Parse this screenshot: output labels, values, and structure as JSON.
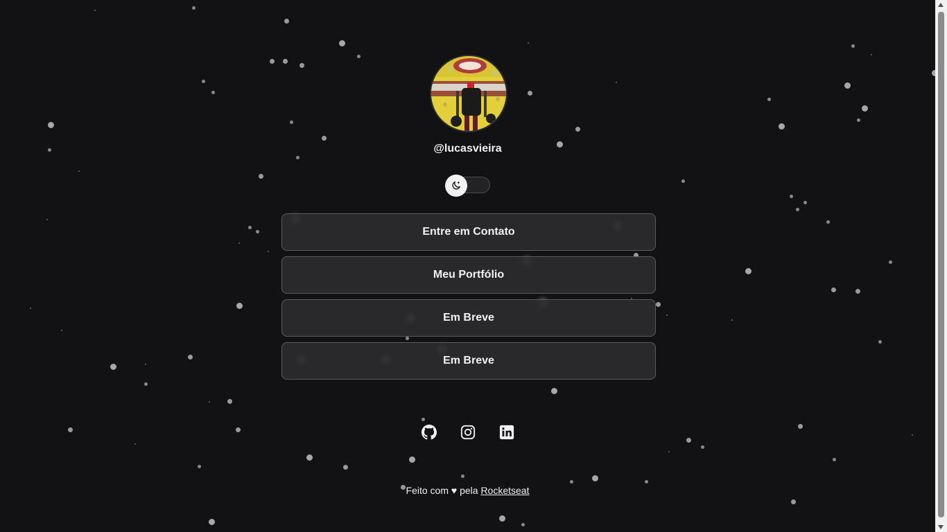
{
  "profile": {
    "username": "@lucasvieira",
    "avatar_icon": "avatar-photo"
  },
  "theme_toggle": {
    "icon": "moon-icon",
    "state": "dark"
  },
  "links": [
    {
      "label": "Entre em Contato"
    },
    {
      "label": "Meu Portfólio"
    },
    {
      "label": "Em Breve"
    },
    {
      "label": "Em Breve"
    }
  ],
  "socials": [
    {
      "icon": "github-icon"
    },
    {
      "icon": "instagram-icon"
    },
    {
      "icon": "linkedin-icon"
    }
  ],
  "footer": {
    "text_before": "Feito com",
    "heart": "♥",
    "text_middle": "pela",
    "link": "Rocketseat"
  },
  "colors": {
    "background": "#121214",
    "button_bg": "#2c2c2f",
    "button_border": "#5d5d61",
    "text": "#f1f1f1"
  }
}
